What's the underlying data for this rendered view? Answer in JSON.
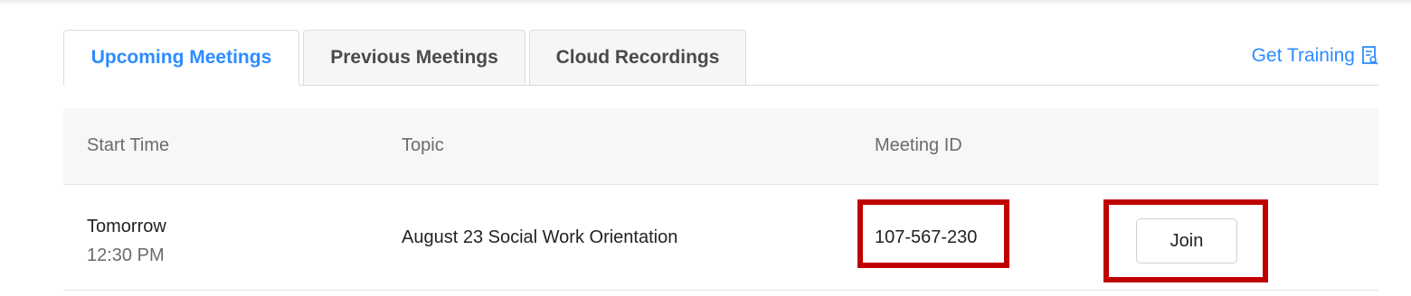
{
  "tabs": [
    {
      "label": "Upcoming Meetings",
      "active": true
    },
    {
      "label": "Previous Meetings",
      "active": false
    },
    {
      "label": "Cloud Recordings",
      "active": false
    }
  ],
  "get_training": {
    "label": "Get Training",
    "icon": "document-search-icon"
  },
  "table": {
    "headers": [
      "Start Time",
      "Topic",
      "Meeting ID"
    ],
    "rows": [
      {
        "start_day": "Tomorrow",
        "start_time": "12:30 PM",
        "topic": "August 23 Social Work Orientation",
        "meeting_id": "107-567-230",
        "action_label": "Join"
      }
    ]
  },
  "colors": {
    "accent": "#2d8cff",
    "highlight": "#c00000"
  }
}
